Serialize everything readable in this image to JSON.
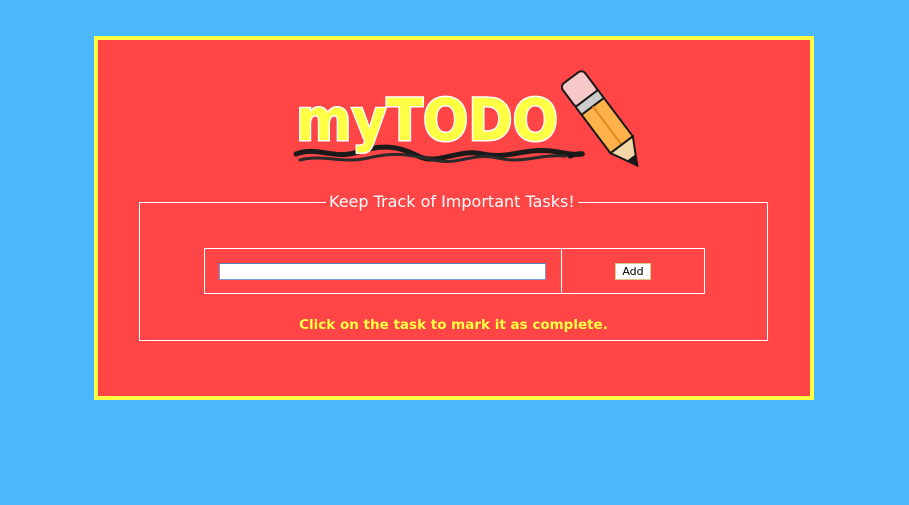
{
  "colors": {
    "page_background": "#4bb8fb",
    "card_background": "#ff4545",
    "card_border": "#ffff44",
    "hint_text": "#ffff44",
    "logo_text": "#ffff44"
  },
  "header": {
    "logo_text": "myTODO",
    "logo_icon": "pencil-icon"
  },
  "task_box": {
    "legend": "Keep Track of Important Tasks!",
    "input_value": "",
    "add_label": "Add",
    "hint": "Click on the task to mark it as complete."
  }
}
